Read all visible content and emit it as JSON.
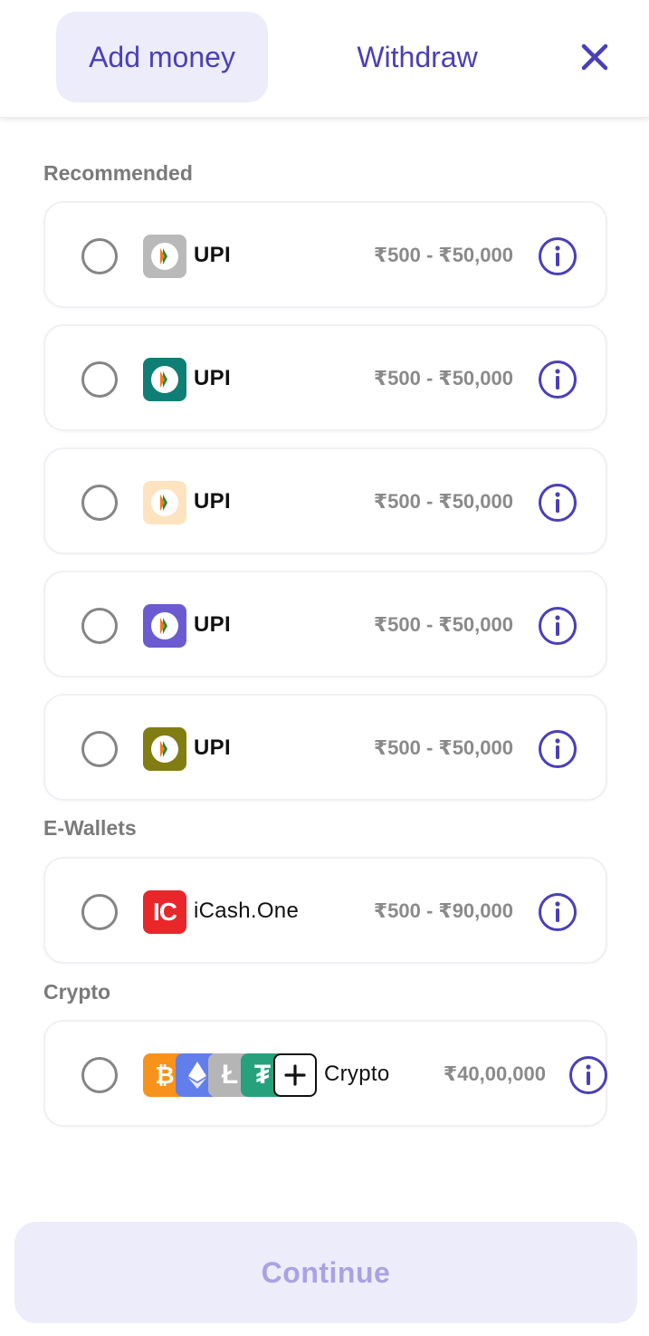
{
  "tabs": {
    "add_money": "Add money",
    "withdraw": "Withdraw"
  },
  "sections": {
    "recommended": "Recommended",
    "ewallets": "E-Wallets",
    "crypto": "Crypto"
  },
  "methods": [
    {
      "name": "UPI",
      "range": "₹500 - ₹50,000",
      "logo_color": "#b9b9b9"
    },
    {
      "name": "UPI",
      "range": "₹500 - ₹50,000",
      "logo_color": "#0f7f76"
    },
    {
      "name": "UPI",
      "range": "₹500 - ₹50,000",
      "logo_color": "#fde3bf"
    },
    {
      "name": "UPI",
      "range": "₹500 - ₹50,000",
      "logo_color": "#6c5bd0"
    },
    {
      "name": "UPI",
      "range": "₹500 - ₹50,000",
      "logo_color": "#827d12"
    }
  ],
  "ewallet": {
    "name": "iCash.One",
    "range": "₹500 - ₹90,000",
    "logo_text": "IC",
    "logo_color": "#e9272b"
  },
  "crypto": {
    "name": "Crypto",
    "range": "₹40,00,000",
    "logos": [
      "bitcoin-icon",
      "ethereum-icon",
      "litecoin-icon",
      "tether-icon",
      "plus-icon"
    ]
  },
  "continue_label": "Continue",
  "colors": {
    "accent": "#4b3fb8",
    "tab_active_bg": "#ececfa",
    "muted_text": "#8a8a8a",
    "continue_text": "#a9a2e2"
  }
}
